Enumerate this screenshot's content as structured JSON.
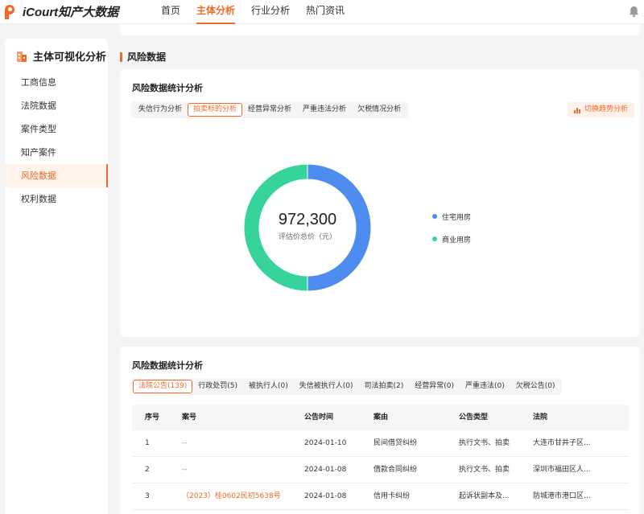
{
  "app": {
    "logo_text": "iCourt知产大数据",
    "nav": [
      "首页",
      "主体分析",
      "行业分析",
      "热门资讯"
    ],
    "nav_active_index": 1
  },
  "sidebar": {
    "title": "主体可视化分析",
    "items": [
      "工商信息",
      "法院数据",
      "案件类型",
      "知产案件",
      "风险数据",
      "权利数据"
    ],
    "active_index": 4
  },
  "section": {
    "title": "风险数据"
  },
  "stats_card": {
    "title": "风险数据统计分析",
    "tabs": [
      "失信行为分析",
      "拍卖标的分析",
      "经营异常分析",
      "严重违法分析",
      "欠税情况分析"
    ],
    "active_tab": 1,
    "switch_button": "切换趋势分析",
    "donut": {
      "value": "972,300",
      "label": "评估价总价（元）",
      "segments": [
        {
          "name": "住宅用房",
          "fraction": 0.5,
          "color": "#4e8cf0"
        },
        {
          "name": "商业用房",
          "fraction": 0.5,
          "color": "#36d39a"
        }
      ]
    }
  },
  "table_card": {
    "title": "风险数据统计分析",
    "tabs": [
      "法院公告(139)",
      "行政处罚(5)",
      "被执行人(0)",
      "失信被执行人(0)",
      "司法拍卖(2)",
      "经营异常(0)",
      "严重违法(0)",
      "欠税公告(0)"
    ],
    "active_tab": 0,
    "columns": [
      "序号",
      "案号",
      "公告时间",
      "案由",
      "公告类型",
      "法院"
    ],
    "rows": [
      [
        "1",
        "--",
        "2024-01-10",
        "民间借贷纠纷",
        "执行文书、拍卖",
        "大连市甘井子区..."
      ],
      [
        "2",
        "--",
        "2024-01-08",
        "借款合同纠纷",
        "执行文书、拍卖",
        "深圳市福田区人..."
      ],
      [
        "3",
        "（2023）桂0602民初5638号",
        "2024-01-08",
        "信用卡纠纷",
        "起诉状副本及...",
        "防城港市港口区..."
      ]
    ]
  },
  "colors": {
    "accent": "#f06a2a"
  },
  "icons": [
    "logo-icon",
    "bell-icon",
    "building-icon",
    "bar-chart-icon"
  ]
}
